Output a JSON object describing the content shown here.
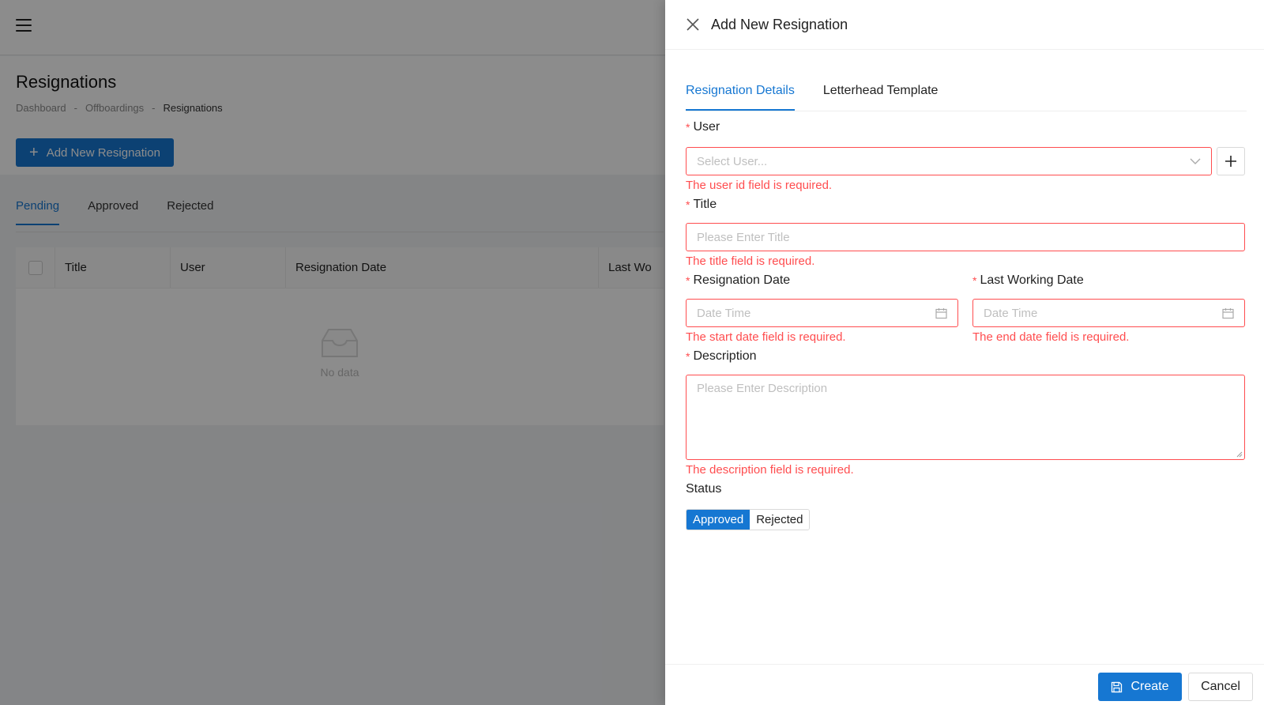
{
  "header": {
    "menu_icon": "hamburger-icon"
  },
  "page": {
    "title": "Resignations",
    "breadcrumb": [
      "Dashboard",
      "-",
      "Offboardings",
      "-",
      "Resignations"
    ],
    "add_button": "Add New Resignation",
    "tabs": [
      "Pending",
      "Approved",
      "Rejected"
    ],
    "active_tab": "Pending",
    "table": {
      "columns": [
        "Title",
        "User",
        "Resignation Date",
        "Last Wo"
      ],
      "empty_text": "No data"
    }
  },
  "drawer": {
    "title": "Add New Resignation",
    "tabs": [
      "Resignation Details",
      "Letterhead Template"
    ],
    "active_tab": "Resignation Details",
    "fields": {
      "user": {
        "label": "User",
        "placeholder": "Select User...",
        "error": "The user id field is required."
      },
      "title": {
        "label": "Title",
        "placeholder": "Please Enter Title",
        "error": "The title field is required."
      },
      "resignation_date": {
        "label": "Resignation Date",
        "placeholder": "Date Time",
        "error": "The start date field is required."
      },
      "last_working_date": {
        "label": "Last Working Date",
        "placeholder": "Date Time",
        "error": "The end date field is required."
      },
      "description": {
        "label": "Description",
        "placeholder": "Please Enter Description",
        "error": "The description field is required."
      },
      "status": {
        "label": "Status",
        "options": [
          "Approved",
          "Rejected"
        ],
        "selected": "Approved"
      }
    },
    "required_mark": "*",
    "footer": {
      "create": "Create",
      "cancel": "Cancel"
    }
  },
  "colors": {
    "accent": "#1677d2",
    "error": "#ff4d4f"
  }
}
